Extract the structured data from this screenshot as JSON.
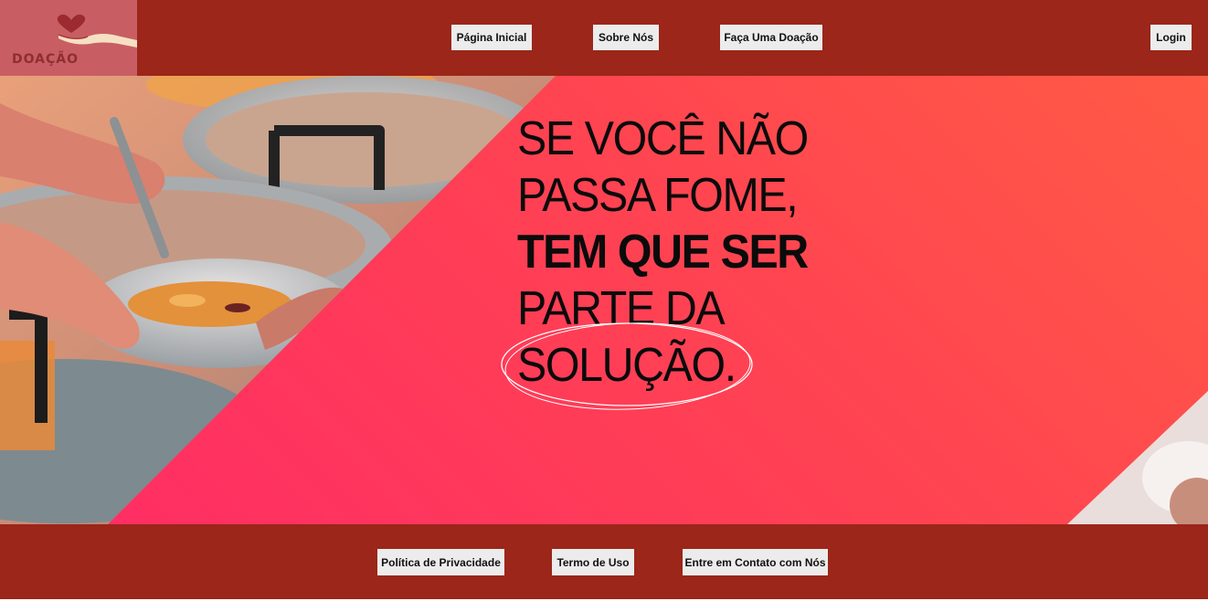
{
  "logo": {
    "text": "DOAÇÃO",
    "icon": "heart-hand-icon"
  },
  "nav": {
    "home": "Página Inicial",
    "about": "Sobre Nós",
    "donate": "Faça Uma Doação",
    "login": "Login"
  },
  "hero": {
    "line1": "SE VOCÊ NÃO",
    "line2": "PASSA FOME,",
    "line3": "TEM QUE SER",
    "line4": "PARTE DA",
    "line5": "SOLUÇÃO."
  },
  "footer": {
    "privacy": "Política de Privacidade",
    "terms": "Termo de Uso",
    "contact": "Entre em Contato com Nós"
  },
  "colors": {
    "bar": "#9b2619",
    "logo_bg": "#c85e63",
    "hero_start": "#ff5a45",
    "hero_end": "#ff2b66",
    "button_bg": "#ececec"
  }
}
